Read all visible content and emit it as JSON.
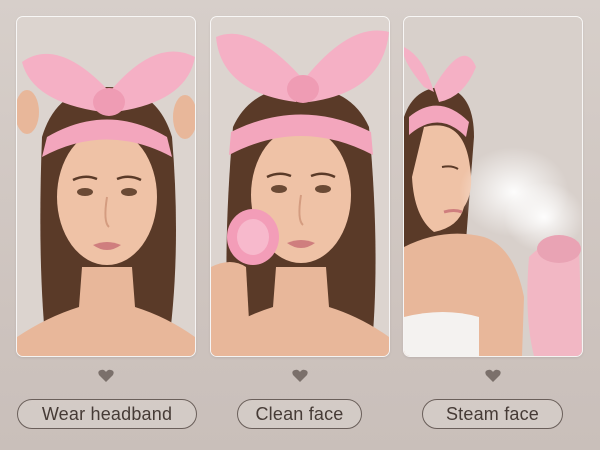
{
  "steps": [
    {
      "label": "Wear headband",
      "icon": "heart-icon"
    },
    {
      "label": "Clean face",
      "icon": "heart-icon"
    },
    {
      "label": "Steam face",
      "icon": "heart-icon"
    }
  ],
  "colors": {
    "background": "#d2c9c4",
    "headband_pink": "#f3a6bd",
    "pill_border": "#6a5f5a",
    "text": "#463b36"
  }
}
